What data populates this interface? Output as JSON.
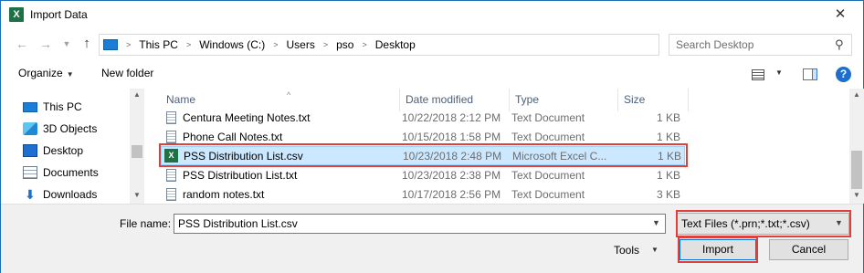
{
  "window": {
    "title": "Import Data",
    "app_icon": "excel-icon",
    "close_label": "✕"
  },
  "address": {
    "crumbs": [
      "This PC",
      "Windows (C:)",
      "Users",
      "pso",
      "Desktop"
    ]
  },
  "search": {
    "placeholder": "Search Desktop"
  },
  "toolbar": {
    "organize_label": "Organize",
    "new_folder_label": "New folder"
  },
  "nav_pane": {
    "items": [
      {
        "label": "This PC",
        "icon": "computer-icon"
      },
      {
        "label": "3D Objects",
        "icon": "cube-icon"
      },
      {
        "label": "Desktop",
        "icon": "desktop-icon"
      },
      {
        "label": "Documents",
        "icon": "documents-icon"
      },
      {
        "label": "Downloads",
        "icon": "download-icon"
      }
    ]
  },
  "file_list": {
    "columns": [
      "Name",
      "Date modified",
      "Type",
      "Size"
    ],
    "rows": [
      {
        "name": "Centura Meeting Notes.txt",
        "date": "10/22/2018 2:12 PM",
        "type": "Text Document",
        "size": "1 KB",
        "icon": "text-file-icon",
        "selected": false
      },
      {
        "name": "Phone Call Notes.txt",
        "date": "10/15/2018 1:58 PM",
        "type": "Text Document",
        "size": "1 KB",
        "icon": "text-file-icon",
        "selected": false
      },
      {
        "name": "PSS Distribution List.csv",
        "date": "10/23/2018 2:48 PM",
        "type": "Microsoft Excel C...",
        "size": "1 KB",
        "icon": "excel-csv-icon",
        "selected": true
      },
      {
        "name": "PSS Distribution List.txt",
        "date": "10/23/2018 2:38 PM",
        "type": "Text Document",
        "size": "1 KB",
        "icon": "text-file-icon",
        "selected": false
      },
      {
        "name": "random notes.txt",
        "date": "10/17/2018 2:56 PM",
        "type": "Text Document",
        "size": "3 KB",
        "icon": "text-file-icon",
        "selected": false
      }
    ]
  },
  "bottom": {
    "file_name_label": "File name:",
    "file_name_value": "PSS Distribution List.csv",
    "file_type_value": "Text Files (*.prn;*.txt;*.csv)",
    "tools_label": "Tools",
    "import_label": "Import",
    "cancel_label": "Cancel"
  },
  "colors": {
    "highlight": "#e0403a",
    "selection_bg": "#cce8ff",
    "accent": "#0078d7"
  }
}
